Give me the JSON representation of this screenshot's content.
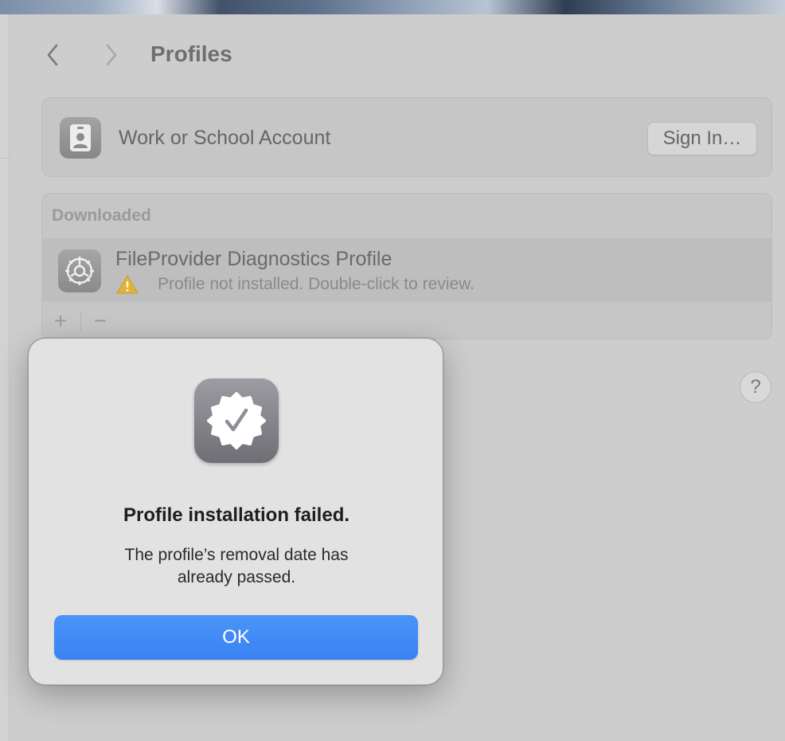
{
  "window": {
    "title": "Profiles"
  },
  "account": {
    "label": "Work or School Account",
    "sign_in_label": "Sign In…"
  },
  "downloaded": {
    "header": "Downloaded",
    "profiles": [
      {
        "name": "FileProvider Diagnostics Profile",
        "status": "Profile not installed. Double-click to review."
      }
    ],
    "add_label": "+",
    "remove_label": "−"
  },
  "help": {
    "label": "?"
  },
  "dialog": {
    "title": "Profile installation failed.",
    "message_line1": "The profile’s removal date has",
    "message_line2": "already passed.",
    "ok_label": "OK"
  },
  "colors": {
    "accent": "#3a82f2",
    "warning": "#e0b43a"
  },
  "icons": {
    "back": "chevron-left-icon",
    "forward": "chevron-right-icon",
    "account": "id-badge-icon",
    "profile": "gear-icon",
    "warning": "warning-triangle-icon",
    "dialog": "verified-seal-checkmark-icon"
  }
}
